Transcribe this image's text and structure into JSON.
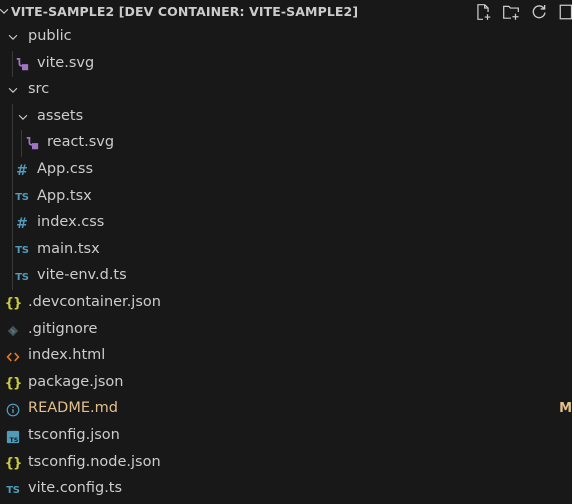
{
  "explorer": {
    "title": "VITE-SAMPLE2 [DEV CONTAINER: VITE-SAMPLE2]",
    "actions": [
      {
        "name": "new-file-icon"
      },
      {
        "name": "new-folder-icon"
      },
      {
        "name": "refresh-icon"
      },
      {
        "name": "collapse-all-icon"
      }
    ]
  },
  "tree": {
    "public": "public",
    "vite_svg": "vite.svg",
    "src": "src",
    "assets": "assets",
    "react_svg": "react.svg",
    "app_css": "App.css",
    "app_tsx": "App.tsx",
    "index_css": "index.css",
    "main_tsx": "main.tsx",
    "vite_env": "vite-env.d.ts",
    "devcontainer": ".devcontainer.json",
    "gitignore": ".gitignore",
    "index_html": "index.html",
    "package_json": "package.json",
    "readme": "README.md",
    "readme_status": "M",
    "tsconfig": "tsconfig.json",
    "tsconfig_node": "tsconfig.node.json",
    "vite_config": "vite.config.ts"
  },
  "icons": {
    "ts": "TS",
    "css": "#",
    "json": "{}"
  },
  "colors": {
    "background": "#181818",
    "text": "#cccccc",
    "modified": "#e2c08d",
    "ts_blue": "#519aba",
    "json_yellow": "#cbcb41",
    "html_orange": "#e37933",
    "svg_purple": "#a074c4"
  }
}
